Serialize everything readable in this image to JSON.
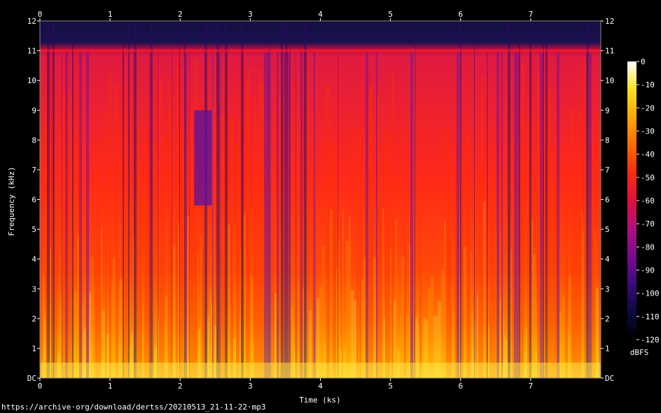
{
  "chart_data": {
    "type": "heatmap",
    "subtype": "spectrogram",
    "xlabel": "Time (ks)",
    "ylabel": "Frequency (kHz)",
    "x_ticks": [
      "0",
      "1",
      "2",
      "3",
      "4",
      "5",
      "6",
      "7"
    ],
    "y_ticks": [
      "DC",
      "1",
      "2",
      "3",
      "4",
      "5",
      "6",
      "7",
      "8",
      "9",
      "10",
      "11",
      "12"
    ],
    "xlim": [
      0,
      8.0
    ],
    "ylim": [
      0,
      12
    ],
    "cutoff_khz": 11,
    "colorbar": {
      "label": "dBFS",
      "ticks": [
        "0",
        "-10",
        "-20",
        "-30",
        "-40",
        "-50",
        "-60",
        "-70",
        "-80",
        "-90",
        "-100",
        "-110",
        "-120"
      ],
      "range": [
        -120,
        0
      ],
      "colors": [
        "#000000",
        "#0a0a40",
        "#3a0a7a",
        "#7a0a90",
        "#b0107a",
        "#e01040",
        "#ff2a10",
        "#ff6a00",
        "#ffa800",
        "#ffe020",
        "#ffffff"
      ]
    },
    "grid": false
  },
  "source_url": "https://archive·org/download/dertss/20210513_21-11-22·mp3"
}
